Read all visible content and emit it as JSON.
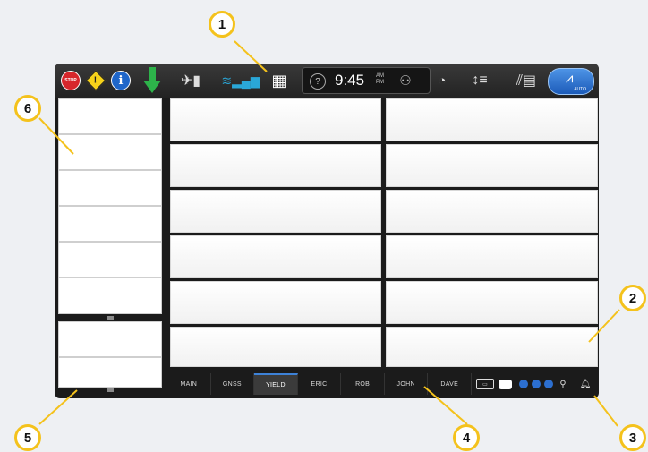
{
  "topbar": {
    "stop_label": "STOP",
    "warn_glyph": "!",
    "info_glyph": "i",
    "clock_time": "9:45",
    "clock_am": "AM",
    "clock_pm": "PM",
    "help_glyph": "?",
    "auto_label": "AUTO"
  },
  "bottom_tabs": [
    {
      "label": "MAIN",
      "active": false
    },
    {
      "label": "GNSS",
      "active": false
    },
    {
      "label": "YIELD",
      "active": true
    },
    {
      "label": "ERIC",
      "active": false
    },
    {
      "label": "ROB",
      "active": false
    },
    {
      "label": "JOHN",
      "active": false
    },
    {
      "label": "DAVE",
      "active": false
    }
  ],
  "callouts": [
    "1",
    "2",
    "3",
    "4",
    "5",
    "6"
  ],
  "colors": {
    "accent": "#f4c21c",
    "auto_button": "#2f7ad6",
    "stop": "#d7262c",
    "warning": "#f6d21a",
    "info": "#1f66c9",
    "arrow": "#2db34a"
  },
  "icons": [
    "stop-icon",
    "warning-icon",
    "info-icon",
    "download-arrow-icon",
    "satellite-icon",
    "wifi-signal-icon",
    "grid-menu-icon",
    "help-icon",
    "user-icon",
    "speedometer-icon",
    "rate-icon",
    "rows-icon",
    "auto-steer-icon",
    "camera-icon",
    "chat-icon",
    "status-dot-icon",
    "plug-icon",
    "bell-icon"
  ]
}
